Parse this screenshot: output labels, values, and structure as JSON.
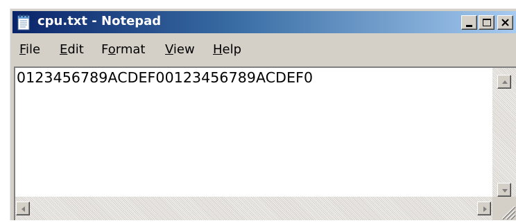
{
  "window": {
    "title": "cpu.txt - Notepad",
    "title_bar_color": "#0a246a",
    "chrome_color": "#d4d0c8"
  },
  "icons": {
    "app": "notepad-icon",
    "minimize": "minimize-icon",
    "maximize": "maximize-icon",
    "close": "close-icon",
    "scroll_up": "arrow-up-icon",
    "scroll_down": "arrow-down-icon",
    "scroll_left": "arrow-left-icon",
    "scroll_right": "arrow-right-icon",
    "resize": "resize-grip-icon"
  },
  "menu": {
    "file": {
      "accel": "F",
      "rest": "ile"
    },
    "edit": {
      "accel": "E",
      "rest": "dit"
    },
    "format": {
      "pre": "F",
      "accel": "o",
      "rest": "rmat"
    },
    "view": {
      "accel": "V",
      "rest": "iew"
    },
    "help": {
      "accel": "H",
      "rest": "elp"
    }
  },
  "editor": {
    "content": "0123456789ACDEF00123456789ACDEF0"
  }
}
